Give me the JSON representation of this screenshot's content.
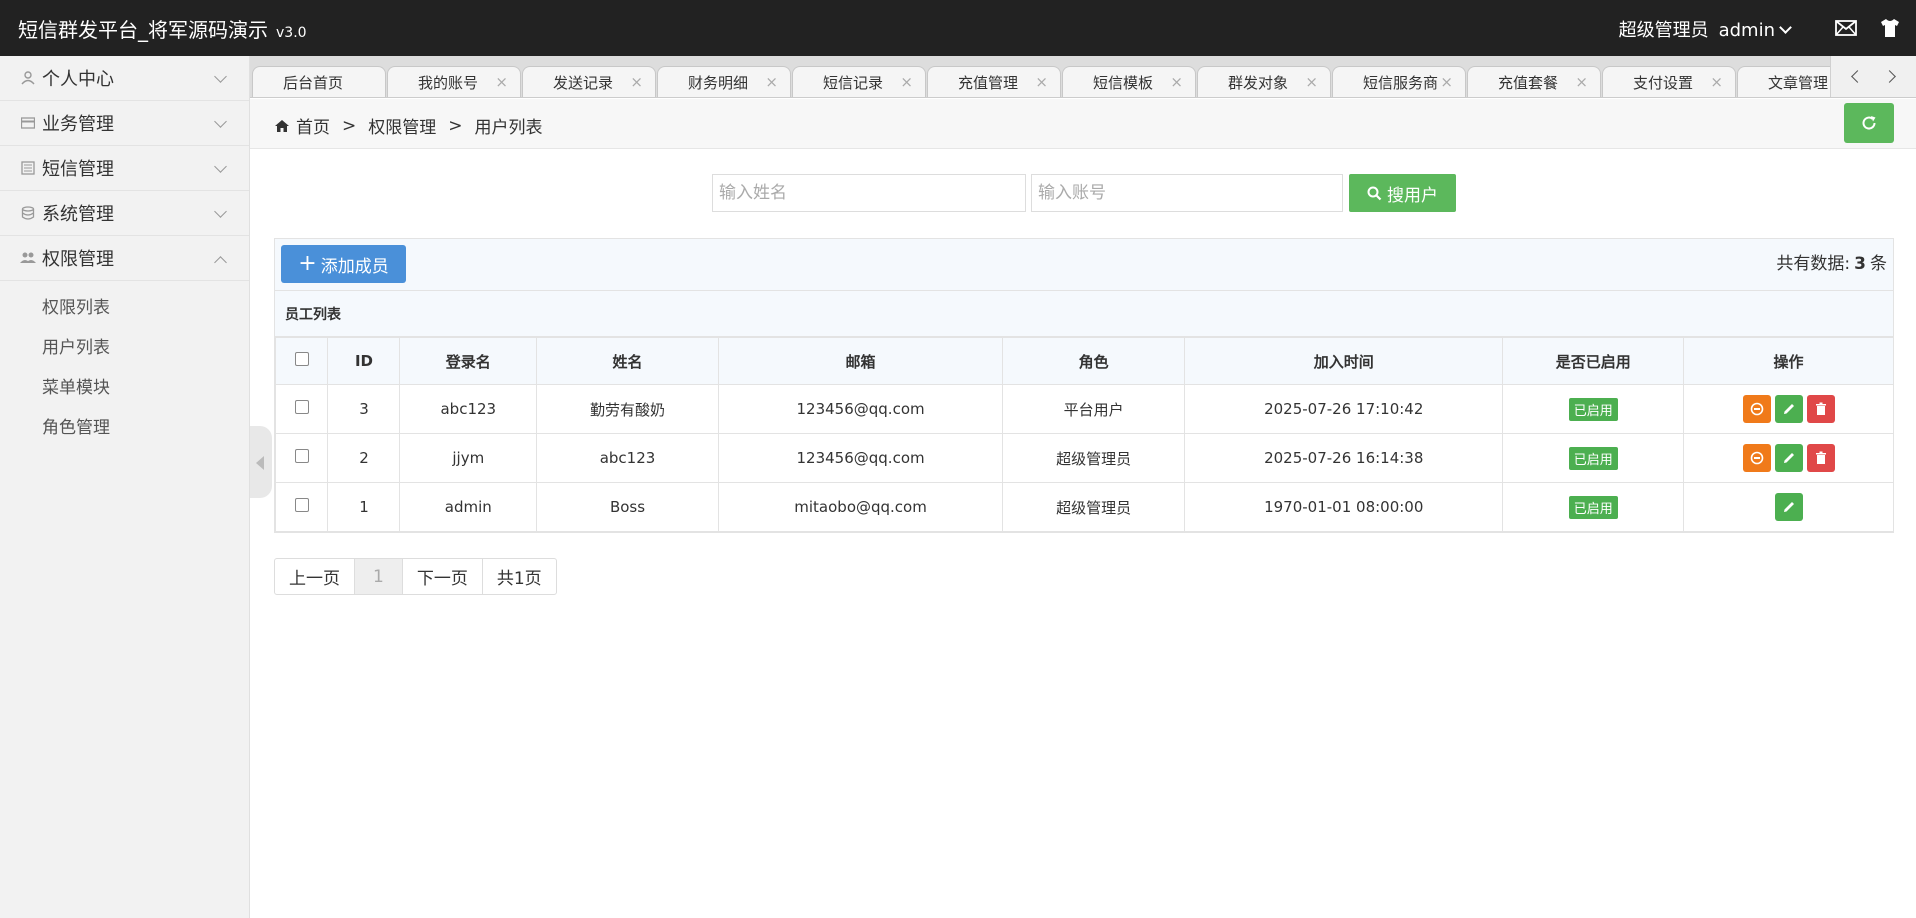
{
  "header": {
    "title": "短信群发平台_将军源码演示",
    "version": "v3.0",
    "role": "超级管理员",
    "username": "admin",
    "icons": [
      "mail-icon",
      "shirt-icon"
    ]
  },
  "sidebar": {
    "items": [
      {
        "label": "个人中心",
        "icon": "user-icon",
        "expanded": false
      },
      {
        "label": "业务管理",
        "icon": "card-icon",
        "expanded": false
      },
      {
        "label": "短信管理",
        "icon": "message-icon",
        "expanded": false
      },
      {
        "label": "系统管理",
        "icon": "database-icon",
        "expanded": false
      },
      {
        "label": "权限管理",
        "icon": "users-icon",
        "expanded": true
      }
    ],
    "sub_items": [
      "权限列表",
      "用户列表",
      "菜单模块",
      "角色管理"
    ]
  },
  "tabs": [
    "后台首页",
    "我的账号",
    "发送记录",
    "财务明细",
    "短信记录",
    "充值管理",
    "短信模板",
    "群发对象",
    "短信服务商",
    "充值套餐",
    "支付设置",
    "文章管理"
  ],
  "breadcrumb": [
    "首页",
    ">",
    "权限管理",
    ">",
    "用户列表"
  ],
  "search": {
    "name_placeholder": "输入姓名",
    "account_placeholder": "输入账号",
    "button_label": "搜用户"
  },
  "toolbar": {
    "add_label": "添加成员",
    "total_prefix": "共有数据:",
    "total_count": "3",
    "total_suffix": "条"
  },
  "list_title": "员工列表",
  "table": {
    "columns": [
      "ID",
      "登录名",
      "姓名",
      "邮箱",
      "角色",
      "加入时间",
      "是否已启用",
      "操作"
    ],
    "rows": [
      {
        "id": "3",
        "login": "abc123",
        "name": "勤劳有酸奶",
        "email": "123456@qq.com",
        "role": "平台用户",
        "joined": "2025-07-26 17:10:42",
        "status": "已启用",
        "actions": [
          "disable",
          "edit",
          "delete"
        ]
      },
      {
        "id": "2",
        "login": "jjym",
        "name": "abc123",
        "email": "123456@qq.com",
        "role": "超级管理员",
        "joined": "2025-07-26 16:14:38",
        "status": "已启用",
        "actions": [
          "disable",
          "edit",
          "delete"
        ]
      },
      {
        "id": "1",
        "login": "admin",
        "name": "Boss",
        "email": "mitaobo@qq.com",
        "role": "超级管理员",
        "joined": "1970-01-01 08:00:00",
        "status": "已启用",
        "actions": [
          "edit"
        ]
      }
    ]
  },
  "pagination": {
    "prev": "上一页",
    "current": "1",
    "next": "下一页",
    "total": "共1页"
  },
  "colors": {
    "header_bg": "#222222",
    "green": "#5cb85c",
    "blue": "#4a90d9",
    "orange": "#f07a1a",
    "red": "#e04848"
  }
}
